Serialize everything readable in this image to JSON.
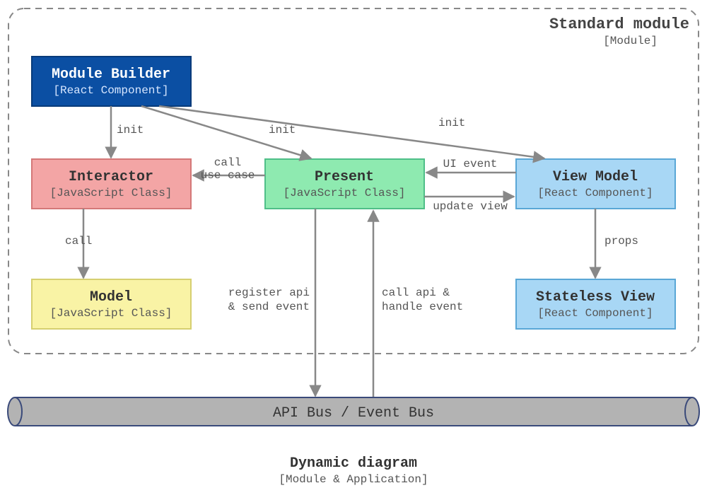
{
  "module": {
    "title": "Standard module",
    "subtitle": "[Module]"
  },
  "boxes": {
    "builder": {
      "title": "Module Builder",
      "subtitle": "[React Component]"
    },
    "interactor": {
      "title": "Interactor",
      "subtitle": "[JavaScript Class]"
    },
    "present": {
      "title": "Present",
      "subtitle": "[JavaScript Class]"
    },
    "viewmodel": {
      "title": "View Model",
      "subtitle": "[React Component]"
    },
    "model": {
      "title": "Model",
      "subtitle": "[JavaScript Class]"
    },
    "stateless": {
      "title": "Stateless View",
      "subtitle": "[React Component]"
    }
  },
  "edges": {
    "init1": "init",
    "init2": "init",
    "init3": "init",
    "call_usecase_l1": "call",
    "call_usecase_l2": "use case",
    "ui_event": "UI event",
    "update_view": "update view",
    "call": "call",
    "props": "props",
    "register_l1": "register api",
    "register_l2": "& send event",
    "callapi_l1": "call api &",
    "callapi_l2": "handle event"
  },
  "bus": {
    "label": "API Bus / Event Bus"
  },
  "caption": {
    "title": "Dynamic diagram",
    "subtitle": "[Module & Application]"
  },
  "colors": {
    "builder_fill": "#0b4fa3",
    "builder_stroke": "#083b7a",
    "interactor_fill": "#f3a5a5",
    "interactor_stroke": "#d47878",
    "present_fill": "#8eeab0",
    "present_stroke": "#4fbf88",
    "view_fill": "#a8d7f5",
    "view_stroke": "#5aa7d6",
    "model_fill": "#f9f3a5",
    "model_stroke": "#d6cf70",
    "bus_fill": "#b3b3b3",
    "bus_stroke": "#3a4a7a",
    "dash": "#888888",
    "arrow": "#888888"
  }
}
